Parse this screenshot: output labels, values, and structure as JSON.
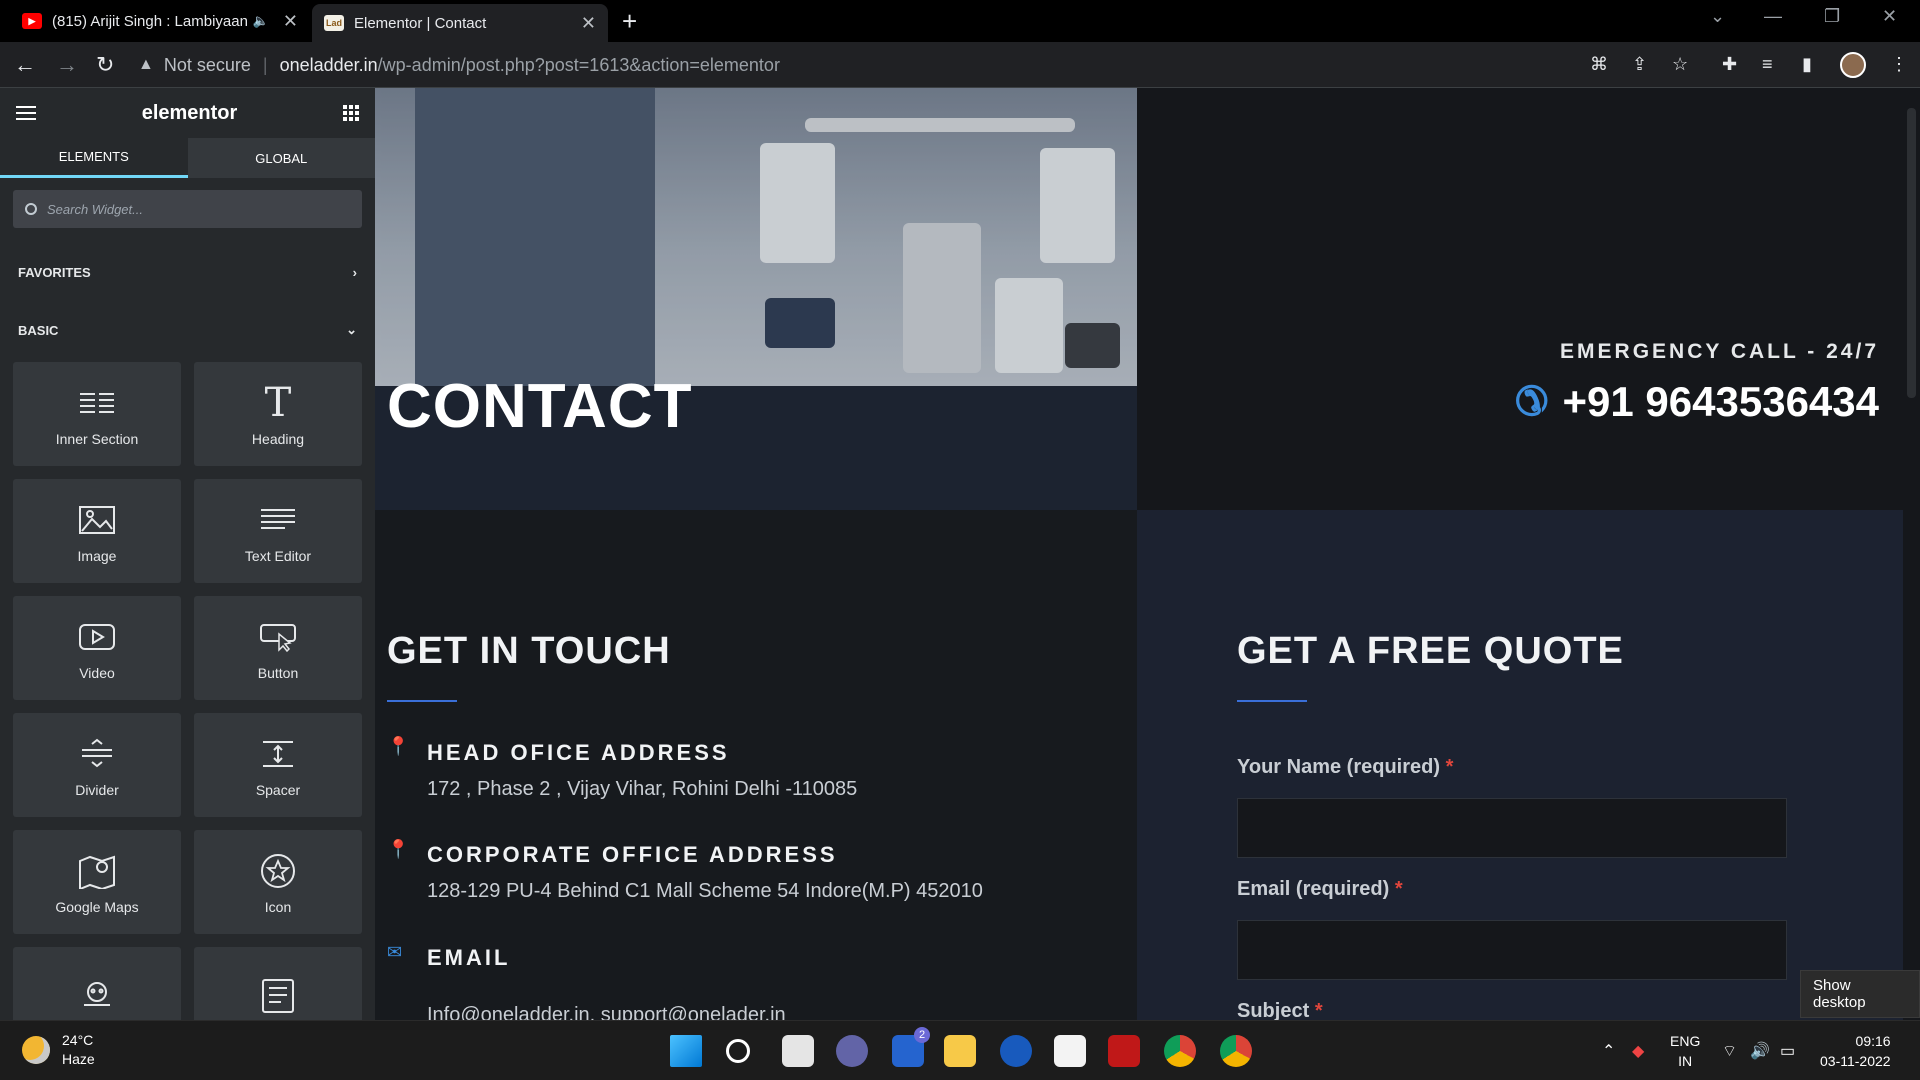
{
  "browser": {
    "tabs": [
      {
        "title": "(815) Arijit Singh : Lambiyaan",
        "active": false
      },
      {
        "title": "Elementor | Contact",
        "active": true
      }
    ],
    "address": {
      "security": "Not secure",
      "host": "oneladder.in",
      "path": "/wp-admin/post.php?post=1613&action=elementor"
    }
  },
  "panel": {
    "brand": "elementor",
    "tabs": [
      "ELEMENTS",
      "GLOBAL"
    ],
    "search_placeholder": "Search Widget...",
    "favorites": "FAVORITES",
    "basic": "BASIC",
    "widgets": [
      {
        "label": "Inner Section",
        "icon": "inner-section-icon"
      },
      {
        "label": "Heading",
        "icon": "heading-icon"
      },
      {
        "label": "Image",
        "icon": "image-icon"
      },
      {
        "label": "Text Editor",
        "icon": "text-editor-icon"
      },
      {
        "label": "Video",
        "icon": "video-icon"
      },
      {
        "label": "Button",
        "icon": "button-icon"
      },
      {
        "label": "Divider",
        "icon": "divider-icon"
      },
      {
        "label": "Spacer",
        "icon": "spacer-icon"
      },
      {
        "label": "Google Maps",
        "icon": "google-maps-icon"
      },
      {
        "label": "Icon",
        "icon": "star-icon"
      }
    ]
  },
  "page": {
    "contact_title": "CONTACT",
    "emergency_label": "EMERGENCY CALL - 24/7",
    "phone": "+91 9643536434",
    "get_in_touch": "GET IN TOUCH",
    "head_office_label": "HEAD OFICE ADDRESS",
    "head_office_address": "172 , Phase 2 , Vijay Vihar, Rohini Delhi -110085",
    "corporate_label": "CORPORATE OFFICE ADDRESS",
    "corporate_address": "128-129 PU-4 Behind C1 Mall Scheme 54 Indore(M.P) 452010",
    "email_label": "EMAIL",
    "email_value": "Info@oneladder.in, support@onelader.in",
    "quote_title": "GET A FREE QUOTE",
    "name_label": "Your Name (required)",
    "email_field_label": "Email (required)",
    "subject_label": "Subject",
    "required_mark": "*",
    "accent": "#3a6fd8"
  },
  "tooltip": "Show desktop",
  "taskbar": {
    "temperature": "24°C",
    "weather": "Haze",
    "lang_top": "ENG",
    "lang_bottom": "IN",
    "time": "09:16",
    "date": "03-11-2022",
    "teams_badge": "2"
  }
}
